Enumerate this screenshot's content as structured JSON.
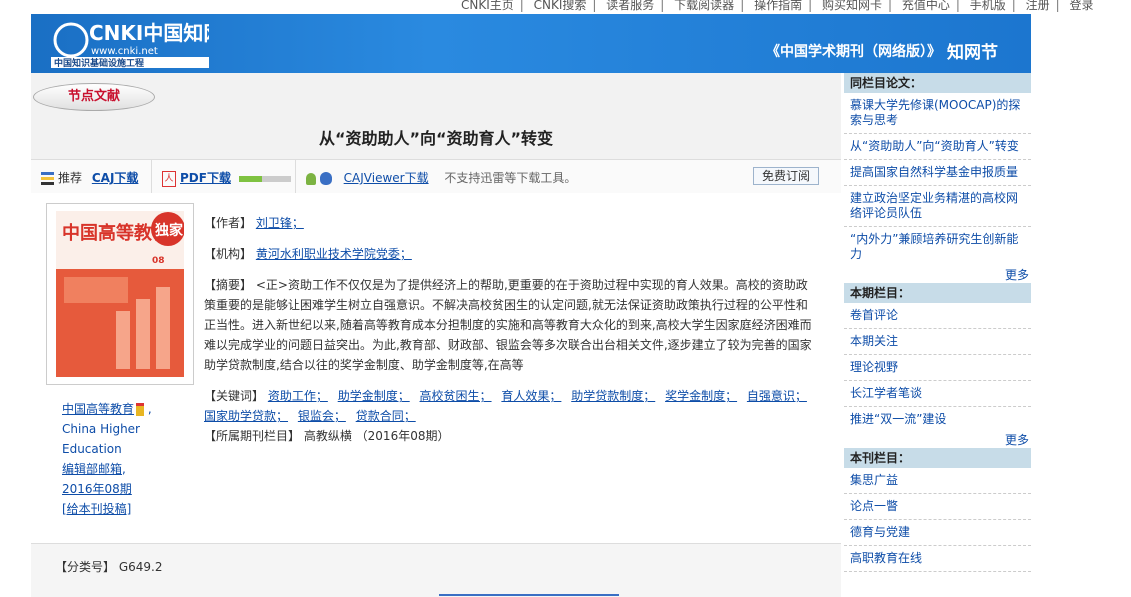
{
  "topnav": {
    "items": [
      "CNKI主页",
      "CNKI搜索",
      "读者服务",
      "下载阅读器",
      "操作指南",
      "购买知网卡",
      "充值中心",
      "手机版",
      "注册",
      "登录"
    ]
  },
  "header": {
    "logo_text": "CNKI中国知网",
    "logo_url_text": "www.cnki.net",
    "logo_subtitle": "中国知识基础设施工程",
    "slogan": "《中国学术期刊（网络版）》",
    "right_mark": "知网节"
  },
  "section_tab": "节点文献",
  "article": {
    "title": "从“资助助人”向“资助育人”转变"
  },
  "toolbar": {
    "recommend": "推荐",
    "caj_download": "CAJ下载",
    "pdf_download": "PDF下载",
    "pdf_progress": 0.45,
    "cajviewer": "CAJViewer下载",
    "notice": "不支持迅雷等下载工具。",
    "subscribe": "免费订阅"
  },
  "cover": {
    "brand": "中国高等教育",
    "badge": "独家",
    "issue": "08"
  },
  "journal": {
    "name_cn": "中国高等教育",
    "name_en": "China Higher Education",
    "editor": "编辑部邮箱",
    "issue": "2016年08期",
    "submit": "[给本刊投稿]"
  },
  "fields": {
    "author_label": "【作者】",
    "author": "刘卫锋；",
    "org_label": "【机构】",
    "org": "黄河水利职业技术学院党委；",
    "abstract_label": "【摘要】",
    "abstract": "<正>资助工作不仅仅是为了提供经济上的帮助,更重要的在于资助过程中实现的育人效果。高校的资助政策重要的是能够让困难学生树立自强意识。不解决高校贫困生的认定问题,就无法保证资助政策执行过程的公平性和正当性。进入新世纪以来,随着高等教育成本分担制度的实施和高等教育大众化的到来,高校大学生因家庭经济困难而难以完成学业的问题日益突出。为此,教育部、财政部、银监会等多次联合出台相关文件,逐步建立了较为完善的国家助学贷款制度,结合以往的奖学金制度、助学金制度等,在高等",
    "keywords_label": "【关键词】",
    "keywords": [
      "资助工作；",
      "助学金制度；",
      "高校贫困生；",
      "育人效果；",
      "助学贷款制度；",
      "奖学金制度；",
      "自强意识；",
      "国家助学贷款；",
      "银监会；",
      "贷款合同；"
    ],
    "column_label": "【所属期刊栏目】",
    "column": "高教纵横 （2016年08期）"
  },
  "classify": {
    "label": "【分类号】",
    "value": "G649.2"
  },
  "sidebar": {
    "sections": [
      {
        "title": "同栏目论文：",
        "items": [
          "慕课大学先修课(MOOCAP)的探索与思考",
          "从“资助助人”向“资助育人”转变",
          "提高国家自然科学基金申报质量",
          "建立政治坚定业务精湛的高校网络评论员队伍",
          "“内外力”兼顾培养研究生创新能力"
        ],
        "more": "更多"
      },
      {
        "title": "本期栏目：",
        "items": [
          "卷首评论",
          "本期关注",
          "理论视野",
          "长江学者笔谈",
          "推进“双一流”建设"
        ],
        "more": "更多"
      },
      {
        "title": "本刊栏目：",
        "items": [
          "集思广益",
          "论点一瞥",
          "德育与党建",
          "高职教育在线"
        ],
        "more": ""
      }
    ]
  },
  "colors": {
    "header_blue": "#1c76cf",
    "link_blue": "#0e4da8",
    "tab_red": "#c8102e",
    "sidebar_head": "#c7dce8"
  }
}
